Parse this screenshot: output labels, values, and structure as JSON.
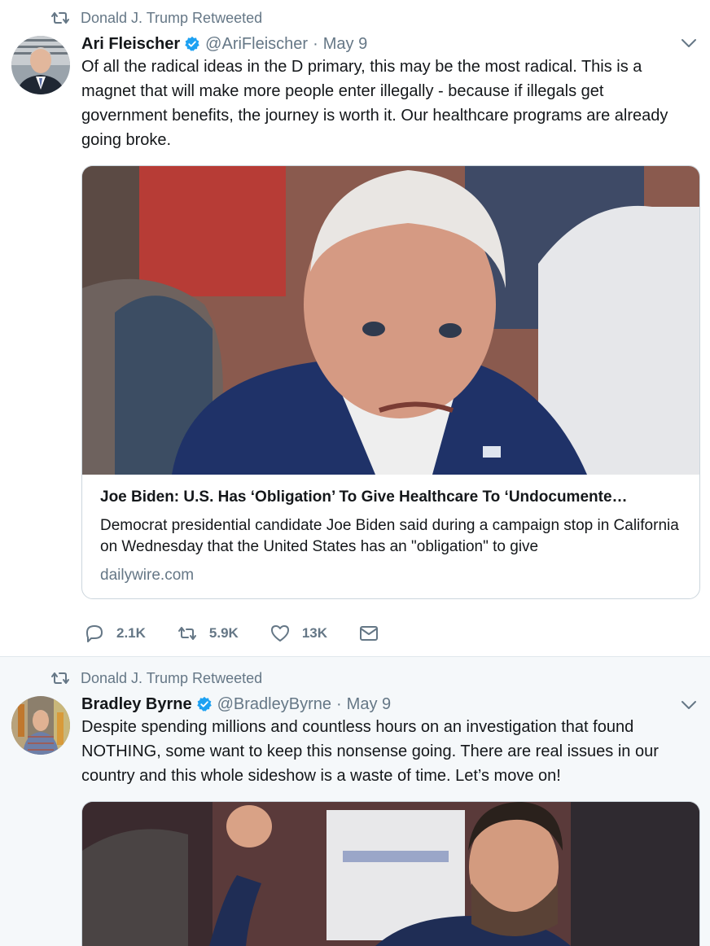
{
  "tweets": [
    {
      "retweet_context": "Donald J. Trump Retweeted",
      "author_name": "Ari Fleischer",
      "handle": "@AriFleischer",
      "separator": "·",
      "time": "May 9",
      "text": "Of all the radical ideas in the D primary, this may be the most radical. This is a magnet that will make more people enter illegally - because if illegals get government benefits, the journey is worth it. Our healthcare programs are already going broke.",
      "card": {
        "title": "Joe Biden: U.S. Has ‘Obligation’ To Give Healthcare To ‘Undocumente…",
        "description": "Democrat presidential candidate Joe Biden said during a campaign stop in California on Wednesday that the United States has an \"obligation\" to give",
        "domain": "dailywire.com"
      },
      "actions": {
        "replies": "2.1K",
        "retweets": "5.9K",
        "likes": "13K"
      }
    },
    {
      "retweet_context": "Donald J. Trump Retweeted",
      "author_name": "Bradley Byrne",
      "handle": "@BradleyByrne",
      "separator": "·",
      "time": "May 9",
      "text": "Despite spending millions and countless hours on an investigation that found NOTHING, some want to keep this nonsense going. There are real issues in our country and this whole sideshow is a waste of time. Let’s move on!"
    }
  ],
  "colors": {
    "text": "#14171a",
    "secondary": "#657786",
    "verified": "#1da1f2",
    "border": "#ccd6dd",
    "alt_background": "#f5f8fa"
  },
  "icons": [
    "retweet-icon",
    "verified-badge-icon",
    "chevron-down-icon",
    "reply-icon",
    "like-icon",
    "mail-icon"
  ]
}
